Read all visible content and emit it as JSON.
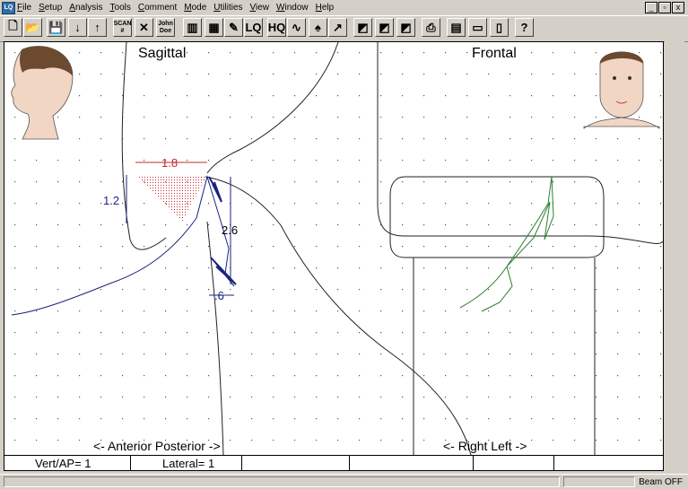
{
  "menu": {
    "items": [
      "File",
      "Setup",
      "Analysis",
      "Tools",
      "Comment",
      "Mode",
      "Utilities",
      "View",
      "Window",
      "Help"
    ]
  },
  "window_controls": {
    "minimize": "_",
    "restore": "▫",
    "close": "x"
  },
  "toolbar": {
    "buttons": [
      {
        "name": "new-file-icon",
        "glyph": "🗋"
      },
      {
        "name": "open-folder-icon",
        "glyph": "📂"
      },
      {
        "name": "save-icon",
        "glyph": "💾"
      },
      {
        "name": "arrow-down-icon",
        "glyph": "↓"
      },
      {
        "name": "arrow-up-icon",
        "glyph": "↑"
      },
      {
        "name": "scan-number-button",
        "glyph": "SCAN #"
      },
      {
        "name": "disabled-tool-icon",
        "glyph": "✕"
      },
      {
        "name": "patient-name-button",
        "glyph": "John Doe"
      },
      {
        "name": "chart-icon",
        "glyph": "▥"
      },
      {
        "name": "bar-chart-icon",
        "glyph": "▦"
      },
      {
        "name": "pencil-icon",
        "glyph": "✎"
      },
      {
        "name": "lq-icon",
        "glyph": "LQ"
      },
      {
        "name": "hq-icon",
        "glyph": "HQ"
      },
      {
        "name": "waveform-icon",
        "glyph": "∿"
      },
      {
        "name": "ink-icon",
        "glyph": "♠"
      },
      {
        "name": "sweep-icon",
        "glyph": "↗"
      },
      {
        "name": "layer-1-icon",
        "glyph": "◩"
      },
      {
        "name": "layer-2-icon",
        "glyph": "◩"
      },
      {
        "name": "layer-3-icon",
        "glyph": "◩"
      },
      {
        "name": "printer-icon",
        "glyph": "⎙"
      },
      {
        "name": "layout-1-icon",
        "glyph": "▤"
      },
      {
        "name": "layout-2-icon",
        "glyph": "▭"
      },
      {
        "name": "layout-3-icon",
        "glyph": "▯"
      },
      {
        "name": "help-cursor-icon",
        "glyph": "?"
      }
    ]
  },
  "plot": {
    "sagittal_title": "Sagittal",
    "frontal_title": "Frontal",
    "anterior_posterior": "<- Anterior  Posterior ->",
    "right_left": "<- Right  Left ->",
    "measure_horizontal": "1.8",
    "measure_vertical": "1.2",
    "measure_diagonal": "2.6",
    "measure_small": ".6",
    "colors": {
      "sagittal_trace": "#1a237e",
      "frontal_trace": "#2e7d32",
      "measure_red": "#c62828",
      "title_blue": "#1a237e",
      "title_green": "#2e7d32"
    }
  },
  "status": {
    "vert_ap": "Vert/AP= 1",
    "lateral": "Lateral= 1"
  },
  "bottom": {
    "beam": "Beam OFF"
  }
}
